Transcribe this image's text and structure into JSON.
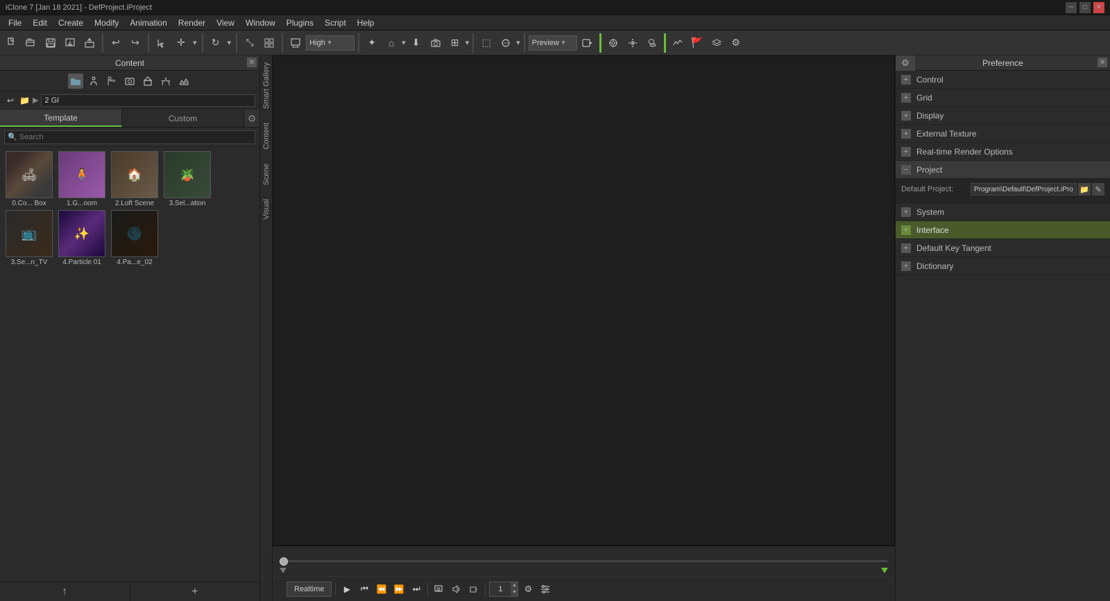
{
  "titlebar": {
    "title": "iClone 7 [Jan 18 2021] - DefProject.iProject",
    "controls": [
      "─",
      "□",
      "✕"
    ]
  },
  "menubar": {
    "items": [
      "File",
      "Edit",
      "Create",
      "Modify",
      "Animation",
      "Render",
      "View",
      "Window",
      "Plugins",
      "Script",
      "Help"
    ]
  },
  "toolbar": {
    "quality_label": "High",
    "preview_label": "Preview"
  },
  "left_panel": {
    "title": "Content",
    "tabs": [
      "Template",
      "Custom"
    ],
    "active_tab": "Template",
    "path": "2 GI",
    "search_placeholder": "Search",
    "thumbnails": [
      {
        "label": "0.Co... Box"
      },
      {
        "label": "1.G...oom"
      },
      {
        "label": "2.Loft Scene"
      },
      {
        "label": "3.Sel...ation"
      },
      {
        "label": "3.Se...n_TV"
      },
      {
        "label": "4.Particle 01"
      },
      {
        "label": "4.Pa...e_02"
      }
    ]
  },
  "right_panel": {
    "title": "Preference",
    "sections": [
      {
        "label": "Control",
        "expanded": false
      },
      {
        "label": "Grid",
        "expanded": false
      },
      {
        "label": "Display",
        "expanded": false
      },
      {
        "label": "External Texture",
        "expanded": false
      },
      {
        "label": "Real-time Render Options",
        "expanded": false
      },
      {
        "label": "Project",
        "expanded": true
      },
      {
        "label": "System",
        "expanded": false
      },
      {
        "label": "Interface",
        "expanded": false,
        "highlighted": true
      },
      {
        "label": "Default Key Tangent",
        "expanded": false
      },
      {
        "label": "Dictionary",
        "expanded": false
      }
    ],
    "project": {
      "default_project_label": "Default Project:",
      "default_project_value": "Program\\Default\\DefProject.iProject"
    }
  },
  "vertical_tabs": {
    "items": [
      "Smart Gallery",
      "Content",
      "Scene",
      "Visual"
    ]
  },
  "playback": {
    "realtime_label": "Realtime",
    "frame_value": "1"
  }
}
